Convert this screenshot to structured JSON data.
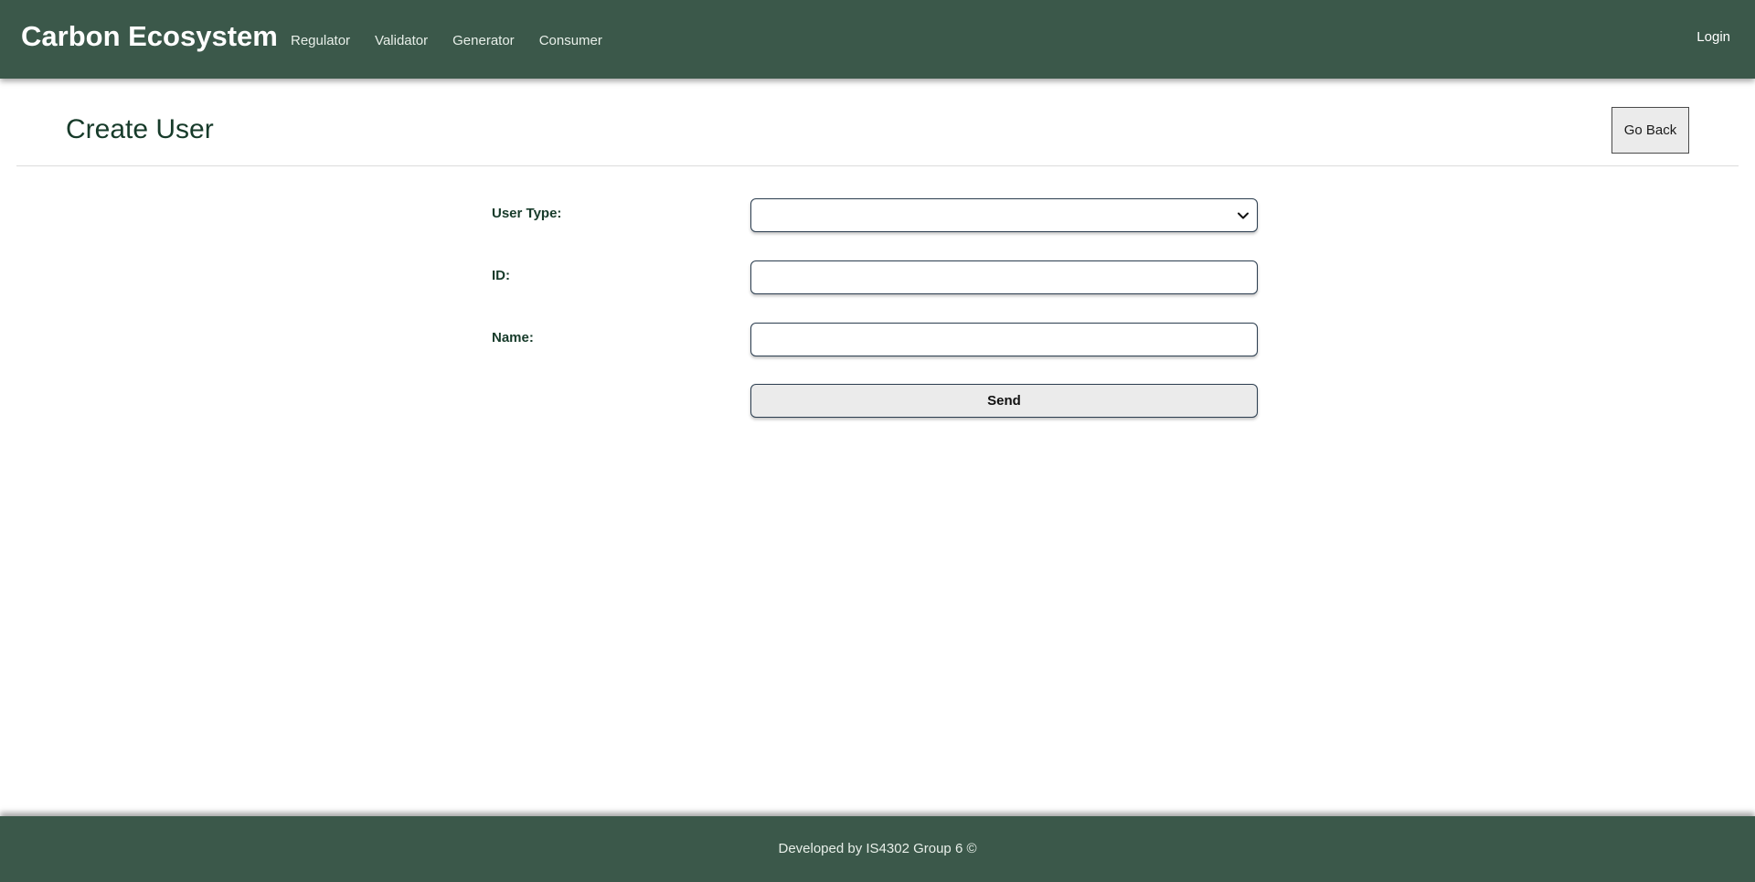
{
  "navbar": {
    "brand": "Carbon Ecosystem",
    "links": [
      "Regulator",
      "Validator",
      "Generator",
      "Consumer"
    ],
    "login": "Login",
    "background": "#3b584a"
  },
  "header": {
    "title": "Create User",
    "go_back_label": "Go Back"
  },
  "form": {
    "user_type_label": "User Type:",
    "user_type_value": "",
    "id_label": "ID:",
    "id_value": "",
    "name_label": "Name:",
    "name_value": "",
    "send_label": "Send"
  },
  "footer": {
    "text": "Developed by IS4302 Group 6 ©"
  },
  "colors": {
    "accent": "#3b584a",
    "title": "#173b2a",
    "button_bg": "#ebebeb"
  },
  "icons": {
    "select_chevron": "chevron-down-icon"
  }
}
